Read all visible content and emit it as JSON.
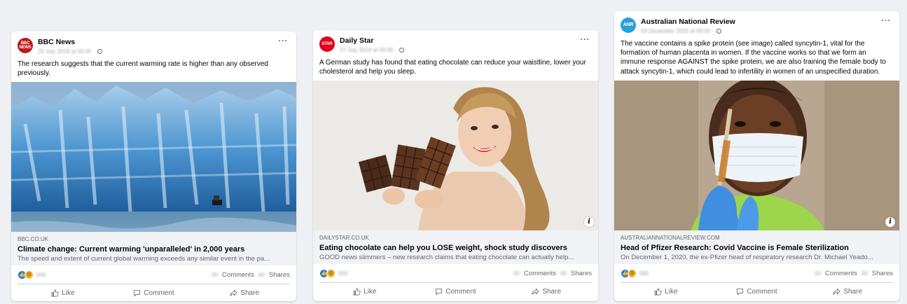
{
  "posts": [
    {
      "page_name": "BBC News",
      "avatar_text": "BBC NEWS",
      "avatar_color": "#bb1919",
      "meta": "25 July 2019 at 00:00",
      "text": "The research suggests that the current warming rate is higher than any observed previously.",
      "image": "glacier",
      "domain": "BBC.CO.UK",
      "title": "Climate change: Current warming 'unparalleled' in 2,000 years",
      "description": "The speed and extent of current global warming exceeds any similar event in the pa...",
      "reaction_count": "000",
      "comments_count": "00",
      "comments_label": "Comments",
      "shares_count": "00",
      "shares_label": "Shares",
      "like_label": "Like",
      "comment_label": "Comment",
      "share_label": "Share"
    },
    {
      "page_name": "Daily Star",
      "avatar_text": "STAR",
      "avatar_color": "#e2001a",
      "meta": "27 July 2019 at 00:00",
      "text": "A German study has found that eating chocolate can reduce your waistline, lower your cholesterol and help you sleep.",
      "image": "chocolate",
      "domain": "DAILYSTAR.CO.UK",
      "title": "Eating chocolate can help you LOSE weight, shock study discovers",
      "description": "GOOD news slimmers – new research claims that eating chocolate can actually help...",
      "reaction_count": "000",
      "comments_count": "00",
      "comments_label": "Comments",
      "shares_count": "00",
      "shares_label": "Shares",
      "like_label": "Like",
      "comment_label": "Comment",
      "share_label": "Share"
    },
    {
      "page_name": "Australian National Review",
      "avatar_text": "ANR",
      "avatar_color": "#2a9fd8",
      "meta": "03 December 2020 at 00:00",
      "text": "The vaccine contains a spike protein (see image) called syncytin-1, vital for the formation of human placenta in women. If the vaccine works so that we form an immune response AGAINST the spike protein, we are also training the female body to attack syncytin-1, which could lead to infertility in women of an unspecified duration.",
      "image": "vaccine",
      "domain": "AUSTRALIANNATIONALREVIEW.COM",
      "title": "Head of Pfizer Research: Covid Vaccine is Female Sterilization",
      "description": "On December 1, 2020, the ex-Pfizer head of respiratory research Dr. Michael Yeado...",
      "reaction_count": "000",
      "comments_count": "00",
      "comments_label": "Comments",
      "shares_count": "00",
      "shares_label": "Shares",
      "like_label": "Like",
      "comment_label": "Comment",
      "share_label": "Share"
    }
  ]
}
